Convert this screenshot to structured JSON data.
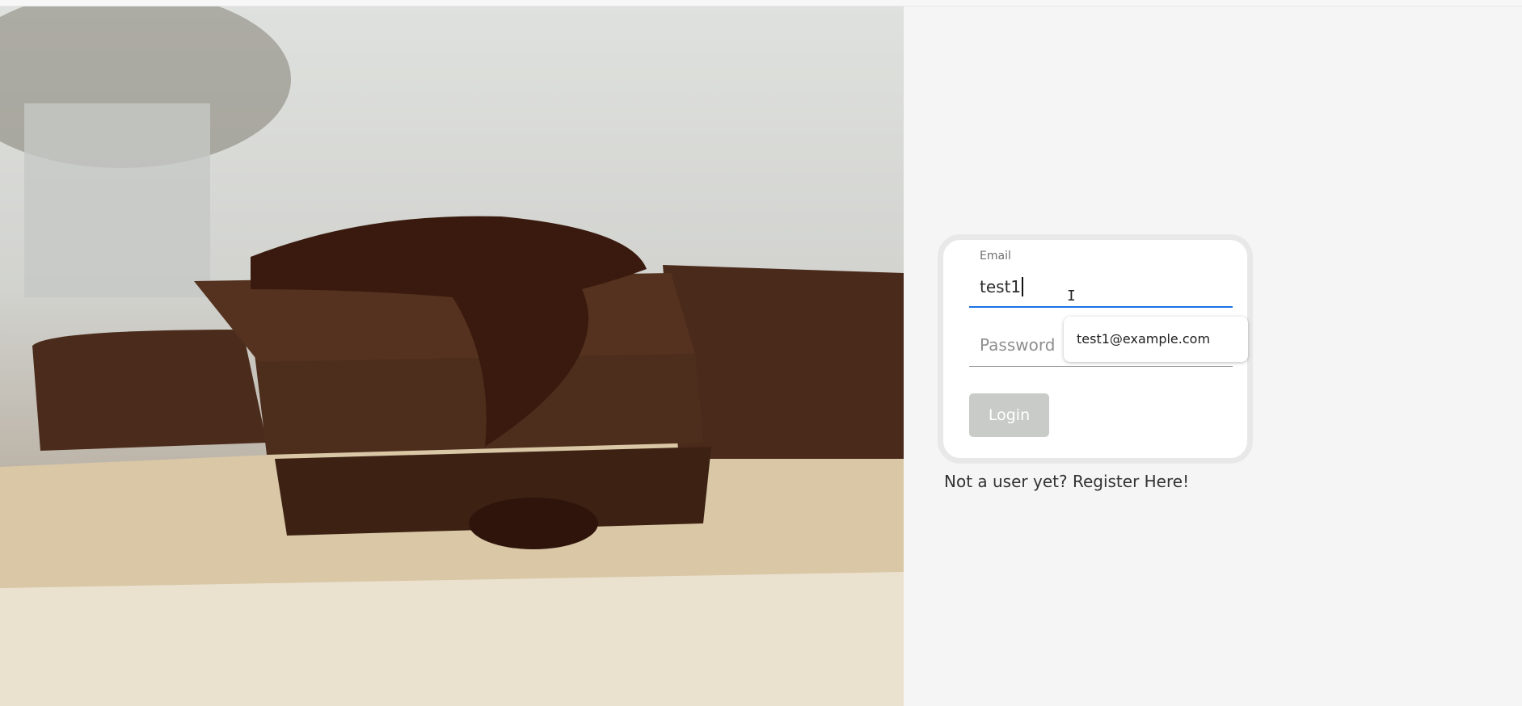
{
  "login_form": {
    "email_label": "Email",
    "email_value": "test1",
    "password_placeholder": "Password",
    "login_button": "Login"
  },
  "autocomplete": {
    "suggestion": "test1@example.com"
  },
  "register_link": "Not a user yet? Register Here!",
  "cursor_glyph": "I",
  "colors": {
    "focus_underline": "#1a73e8",
    "login_button_bg": "#c9cbc8",
    "page_bg": "#f5f5f5"
  }
}
